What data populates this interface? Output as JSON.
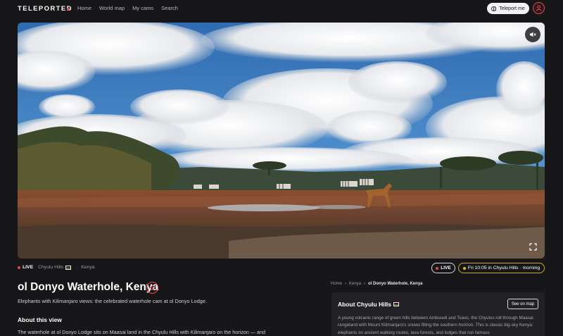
{
  "nav": {
    "logo": "TELEPORTED",
    "links": [
      "Home",
      "World map",
      "My cams",
      "Search"
    ],
    "teleport_label": "Teleport me"
  },
  "video": {
    "muted": true,
    "icons": [
      "mute-icon",
      "fullscreen-icon"
    ]
  },
  "status": {
    "live_label": "LIVE",
    "region": "Chyulu Hills",
    "country": "Kenya",
    "pill_live": "LIVE",
    "local_time": "Fri 10:05 in Chyulu Hills · morning"
  },
  "main": {
    "title": "ol Donyo Waterhole, Kenya",
    "subtitle": "Elephants with Kilimanjaro views: the celebrated waterhole cam at ol Donyo Lodge.",
    "about_heading": "About this view",
    "about_text": "The waterhole at ol Donyo Lodge sits on Maasai land in the Chyulu Hills with Kilimanjaro on the horizon — and"
  },
  "breadcrumb": {
    "items": [
      "Home",
      "Kenya",
      "ol Donyo Waterhole, Kenya"
    ]
  },
  "side_card": {
    "title": "About Chyulu Hills",
    "button": "See on map",
    "text": "A young volcanic range of green hills between Amboseli and Tsavo, the Chyulus roll through Maasai rangeland with Mount Kilimanjaro's snows filling the southern horizon. This is classic big-sky Kenya: elephants on ancient walking routes, lava forests, and lodges that run famous"
  },
  "colors": {
    "accent_red": "#e5484d",
    "accent_gold": "#d6a726",
    "background": "#17171a",
    "card": "#222226"
  }
}
